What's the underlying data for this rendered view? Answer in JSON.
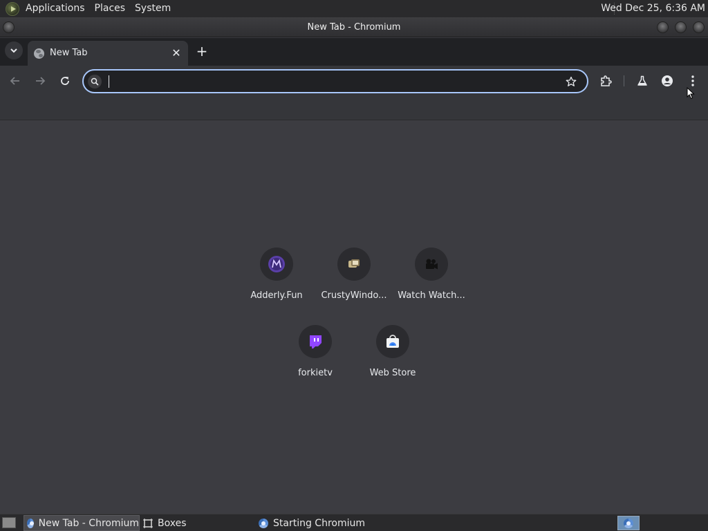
{
  "top_panel": {
    "menus": [
      "Applications",
      "Places",
      "System"
    ],
    "clock": "Wed Dec 25,  6:36 AM"
  },
  "window": {
    "title": "New Tab - Chromium"
  },
  "tabs": [
    {
      "title": "New Tab",
      "active": true
    }
  ],
  "toolbar": {
    "omnibox_value": ""
  },
  "shortcuts": [
    {
      "label": "Adderly.Fun",
      "icon": "adderly-icon"
    },
    {
      "label": "CrustyWindo...",
      "icon": "crustywindows-icon"
    },
    {
      "label": "Watch Watch...",
      "icon": "video-camera-icon"
    },
    {
      "label": "forkietv",
      "icon": "twitch-icon"
    },
    {
      "label": "Web Store",
      "icon": "webstore-icon"
    }
  ],
  "taskbar": {
    "tasks": [
      {
        "label": "New Tab - Chromium",
        "icon": "chromium-icon",
        "active": true
      },
      {
        "label": "Boxes",
        "icon": "boxes-icon",
        "active": false
      },
      {
        "label": "Starting Chromium",
        "icon": "chromium-icon",
        "active": false
      }
    ]
  },
  "colors": {
    "accent": "#a8c7fa",
    "page_bg": "#3c3c41",
    "toolbar_bg": "#35363a",
    "tabstrip_bg": "#202124"
  }
}
